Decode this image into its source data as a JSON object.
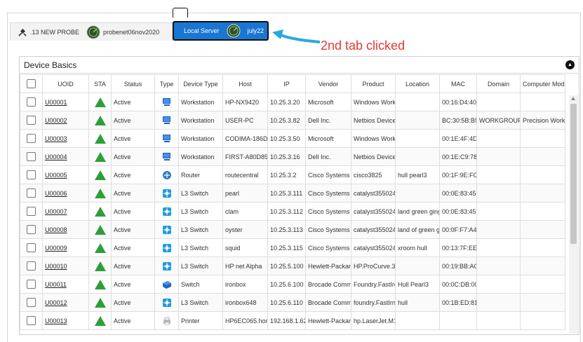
{
  "tabs": [
    {
      "label": ".13 NEW PROBE",
      "sub": "probenet06nov2020",
      "active": false
    },
    {
      "label": "Local Server",
      "sub": "july22",
      "active": true
    }
  ],
  "annotation": "2nd tab clicked",
  "panel": {
    "title": "Device Basics"
  },
  "colors": {
    "accent": "#1976d2",
    "status_green": "#2e9e3a",
    "annotation": "#e53935",
    "arrow": "#29a8e0"
  },
  "columns": [
    "UOID",
    "STA",
    "Status",
    "Type",
    "Device Type",
    "Host",
    "IP",
    "Vendor",
    "Product",
    "Location",
    "MAC",
    "Domain",
    "Computer Mod"
  ],
  "rows": [
    {
      "uoid": "U00001",
      "status": "Active",
      "type_icon": "workstation-icon",
      "device_type": "Workstation",
      "host": "HP-NX9420",
      "ip": "10.25.3.20",
      "vendor": "Microsoft",
      "product": "Windows Work",
      "location": "",
      "mac": "00:16:D4:40",
      "domain": "",
      "model": ""
    },
    {
      "uoid": "U00002",
      "status": "Active",
      "type_icon": "workstation-icon",
      "device_type": "Workstation",
      "host": "USER-PC",
      "ip": "10.25.3.82",
      "vendor": "Dell Inc.",
      "product": "Netbios Device",
      "location": "",
      "mac": "BC:30:5B:B5",
      "domain": "WORKGROUP",
      "model": "Precision Work5"
    },
    {
      "uoid": "U00003",
      "status": "Active",
      "type_icon": "workstation-icon",
      "device_type": "Workstation",
      "host": "CODIMA-186D",
      "ip": "10.25.3.50",
      "vendor": "Microsoft",
      "product": "Windows Work",
      "location": "",
      "mac": "00:1E:4F:4D",
      "domain": "",
      "model": ""
    },
    {
      "uoid": "U00004",
      "status": "Active",
      "type_icon": "workstation-icon",
      "device_type": "Workstation",
      "host": "FIRST-A80D85",
      "ip": "10.25.3.16",
      "vendor": "Dell Inc.",
      "product": "Netbios Device",
      "location": "",
      "mac": "00:1E:C9:78",
      "domain": "",
      "model": ""
    },
    {
      "uoid": "U00005",
      "status": "Active",
      "type_icon": "router-icon",
      "device_type": "Router",
      "host": "routecentral",
      "ip": "10.25.3.2",
      "vendor": "Cisco Systems",
      "product": "cisco3825",
      "location": "hull pearl3",
      "mac": "00:1F:9E:FC",
      "domain": "",
      "model": ""
    },
    {
      "uoid": "U00006",
      "status": "Active",
      "type_icon": "l3-switch-icon",
      "device_type": "L3 Switch",
      "host": "pearl",
      "ip": "10.25.3.111",
      "vendor": "Cisco Systems",
      "product": "catalyst355024",
      "location": "",
      "mac": "00:0E:83:45",
      "domain": "",
      "model": ""
    },
    {
      "uoid": "U00007",
      "status": "Active",
      "type_icon": "l3-switch-icon",
      "device_type": "L3 Switch",
      "host": "clam",
      "ip": "10.25.3.112",
      "vendor": "Cisco Systems",
      "product": "catalyst355024",
      "location": "land green ging",
      "mac": "00:0E:83:45",
      "domain": "",
      "model": ""
    },
    {
      "uoid": "U00008",
      "status": "Active",
      "type_icon": "l3-switch-icon",
      "device_type": "L3 Switch",
      "host": "oyster",
      "ip": "10.25.3.113",
      "vendor": "Cisco Systems",
      "product": "catalyst355024",
      "location": "land of green g",
      "mac": "00:0F:F7:A4",
      "domain": "",
      "model": ""
    },
    {
      "uoid": "U00009",
      "status": "Active",
      "type_icon": "l3-switch-icon",
      "device_type": "L3 Switch",
      "host": "squid",
      "ip": "10.25.3.115",
      "vendor": "Cisco Systems",
      "product": "catalyst355024",
      "location": "xroom hull",
      "mac": "00:13:7F:EE",
      "domain": "",
      "model": ""
    },
    {
      "uoid": "U00010",
      "status": "Active",
      "type_icon": "l3-switch-icon",
      "device_type": "L3 Switch",
      "host": "HP net Alpha",
      "ip": "10.25.5.100",
      "vendor": "Hewlett-Packar",
      "product": "HP.ProCurve.3",
      "location": "",
      "mac": "00:19:BB:AC",
      "domain": "",
      "model": ""
    },
    {
      "uoid": "U00011",
      "status": "Active",
      "type_icon": "switch-icon",
      "device_type": "Switch",
      "host": "ironbox",
      "ip": "10.25.6.100",
      "vendor": "Brocade Comm",
      "product": "Foundry.FastIro",
      "location": "Hull Pearl3",
      "mac": "00:0C:DB:00",
      "domain": "",
      "model": ""
    },
    {
      "uoid": "U00012",
      "status": "Active",
      "type_icon": "l3-switch-icon",
      "device_type": "L3 Switch",
      "host": "ironbox648",
      "ip": "10.25.6.110",
      "vendor": "Brocade Comm",
      "product": "foundry.FastIrn",
      "location": "hull",
      "mac": "00:1B:ED:81",
      "domain": "",
      "model": ""
    },
    {
      "uoid": "U00013",
      "status": "Active",
      "type_icon": "printer-icon",
      "device_type": "Printer",
      "host": "HP6EC065.hor",
      "ip": "192.168.1.62",
      "vendor": "Hewlett-Packar",
      "product": "hp.LaserJet.M1",
      "location": "",
      "mac": "",
      "domain": "",
      "model": ""
    }
  ]
}
